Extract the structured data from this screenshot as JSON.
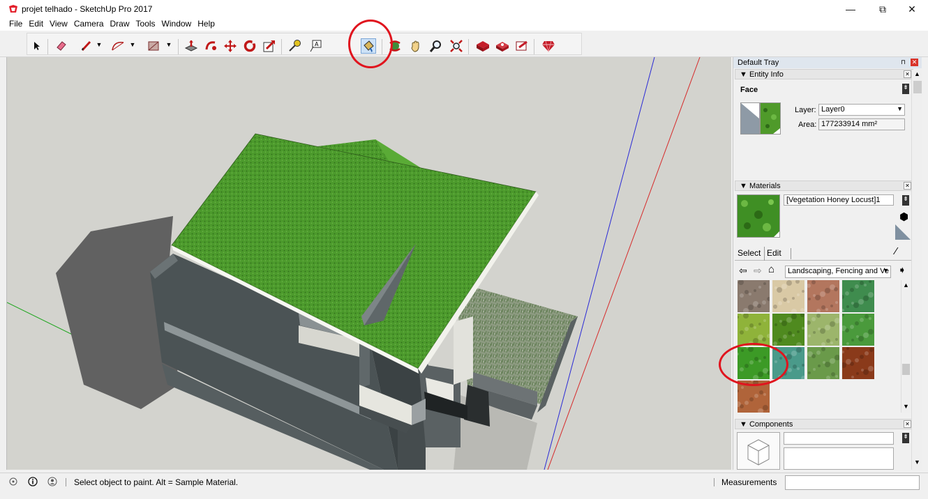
{
  "window": {
    "title": "projet telhado - SketchUp Pro 2017",
    "minimize": "—",
    "restore": "⧉",
    "close": "✕"
  },
  "menu": [
    "File",
    "Edit",
    "View",
    "Camera",
    "Draw",
    "Tools",
    "Window",
    "Help"
  ],
  "toolbar": {
    "active_tool": "paint-bucket-tool"
  },
  "tray": {
    "title": "Default Tray",
    "pin": "⊓",
    "close": "✕",
    "entity_info": {
      "header": "▼ Entity Info",
      "type": "Face",
      "layer_label": "Layer:",
      "layer_value": "Layer0",
      "area_label": "Area:",
      "area_value": "177233914 mm²"
    },
    "materials": {
      "header": "▼ Materials",
      "name": "[Vegetation Honey Locust]1",
      "tab_select": "Select",
      "tab_edit": "Edit",
      "collection": "Landscaping, Fencing and Ve",
      "swatch_colors": [
        [
          "#8a7a6e",
          "#d9c9a5",
          "#b3765e",
          "#3f8c4e"
        ],
        [
          "#8fb33a",
          "#4f8a1f",
          "#9cb56b",
          "#4a9a3c"
        ],
        [
          "#3c9a26",
          "#4a9a8a",
          "#6a9a4a",
          "#8a3a1a"
        ],
        [
          "#b0643a"
        ]
      ],
      "selected_swatch": "vegetation-honey-locust"
    },
    "components": {
      "header": "▼ Components"
    }
  },
  "statusbar": {
    "text": "Select object to paint. Alt = Sample Material.",
    "measurements_label": "Measurements",
    "measurements_value": ""
  },
  "colors": {
    "roof_green": "#4e9a2e",
    "wall_dark": "#4d5557",
    "sky": "#d3d3ce",
    "annotation_red": "#e0141e"
  }
}
